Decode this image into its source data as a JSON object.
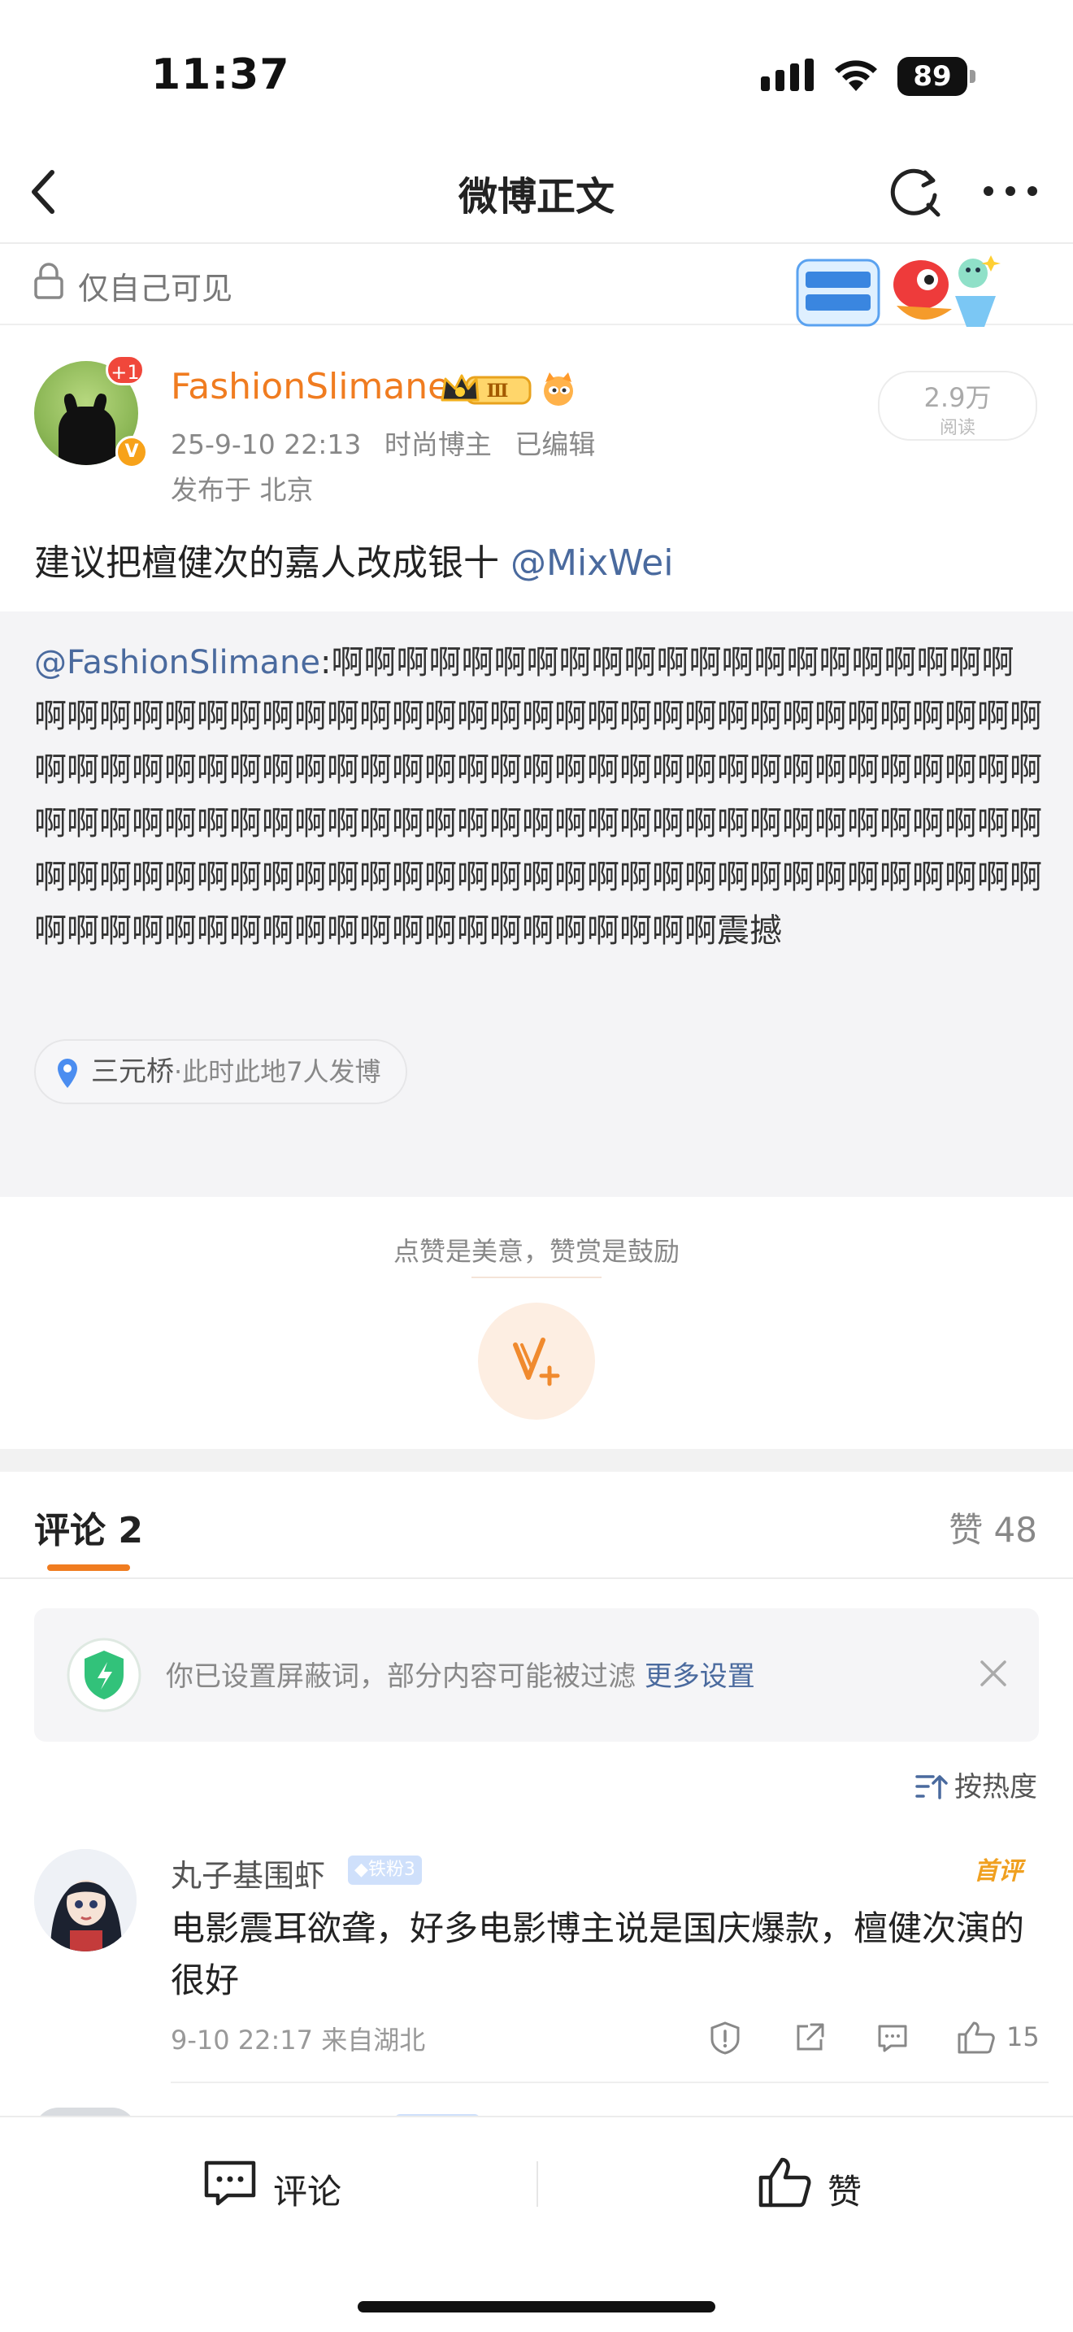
{
  "status_bar": {
    "time": "11:37",
    "battery": "89"
  },
  "nav": {
    "title": "微博正文"
  },
  "visibility": {
    "text": "仅自己可见"
  },
  "author": {
    "name": "FashionSlimane",
    "avatar_badge": "+1",
    "verified_mark": "V",
    "level_badge": "Ⅲ",
    "time": "25-9-10 22:13",
    "category": "时尚博主",
    "edited": "已编辑",
    "location": "发布于 北京",
    "reads_count": "2.9万",
    "reads_label": "阅读"
  },
  "post": {
    "text": "建议把檀健次的嘉人改成银十",
    "mention": "@MixWei"
  },
  "quote": {
    "mention": "@FashionSlimane",
    "text": ":啊啊啊啊啊啊啊啊啊啊啊啊啊啊啊啊啊啊啊啊啊啊啊啊啊啊啊啊啊啊啊啊啊啊啊啊啊啊啊啊啊啊啊啊啊啊啊啊啊啊啊啊啊啊啊啊啊啊啊啊啊啊啊啊啊啊啊啊啊啊啊啊啊啊啊啊啊啊啊啊啊啊啊啊啊啊啊啊啊啊啊啊啊啊啊啊啊啊啊啊啊啊啊啊啊啊啊啊啊啊啊啊啊啊啊啊啊啊啊啊啊啊啊啊啊啊啊啊啊啊啊啊啊啊啊啊啊啊啊啊啊啊啊啊啊啊啊啊啊啊啊啊啊啊啊啊啊啊啊啊啊啊啊啊啊啊震撼",
    "place": "三元桥",
    "place_extra": "·此时此地7人发博"
  },
  "reward": {
    "tip": "点赞是美意，赞赏是鼓励"
  },
  "comments_header": {
    "tab": "评论 2",
    "likes": "赞 48"
  },
  "notice": {
    "text": "你已设置屏蔽词，部分内容可能被过滤",
    "link": "更多设置"
  },
  "sort": {
    "label": "按热度"
  },
  "comment": {
    "name": "丸子基围虾",
    "fan_badge": "铁粉3",
    "first_badge": "首评",
    "text": "电影震耳欲聋，好多电影博主说是国庆爆款，檀健次演的很好",
    "time": "9-10 22:17",
    "location": "来自湖北",
    "like_count": "15"
  },
  "bottom": {
    "comment_label": "评论",
    "like_label": "赞"
  },
  "colors": {
    "accent": "#f07c20",
    "link": "#4a6a9e",
    "quote_bg": "#f4f4f6"
  }
}
